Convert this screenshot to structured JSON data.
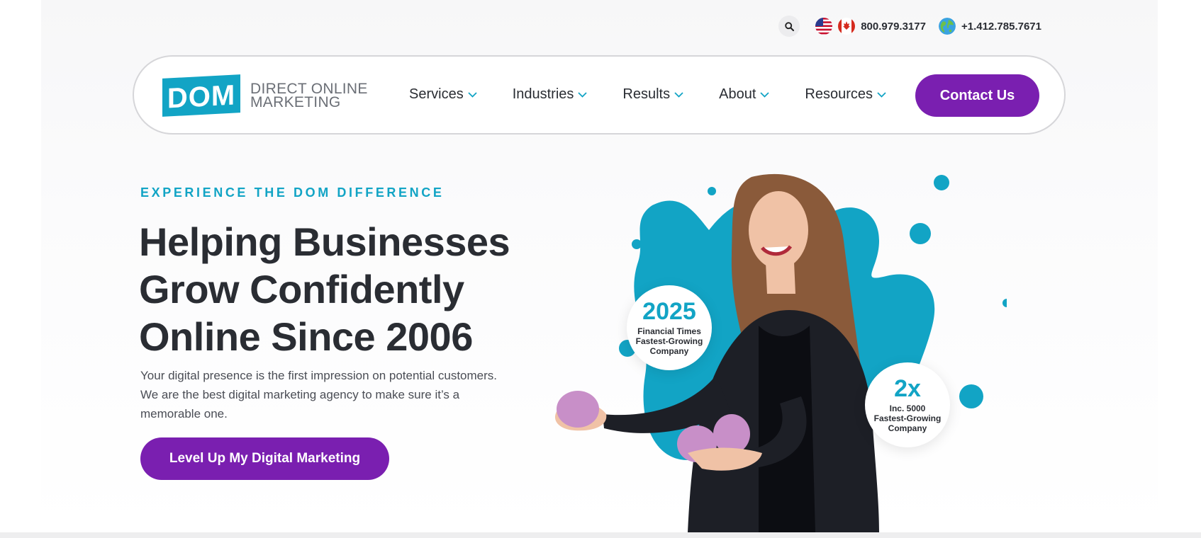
{
  "utility": {
    "phone_us_ca": "800.979.3177",
    "phone_intl": "+1.412.785.7671"
  },
  "logo": {
    "mark": "DOM",
    "line1": "DIRECT ONLINE",
    "line2": "MARKETING"
  },
  "nav": {
    "items": [
      {
        "label": "Services"
      },
      {
        "label": "Industries"
      },
      {
        "label": "Results"
      },
      {
        "label": "About"
      },
      {
        "label": "Resources"
      }
    ],
    "contact_label": "Contact Us"
  },
  "hero": {
    "eyebrow": "EXPERIENCE THE DOM DIFFERENCE",
    "headline_line1": "Helping Businesses",
    "headline_line2": "Grow Confidently",
    "headline_line3": "Online Since 2006",
    "subtext": "Your digital presence is the first impression on potential customers. We are the best digital marketing agency to make sure it’s a memorable one.",
    "cta_label": "Level Up My Digital Marketing"
  },
  "badges": {
    "ft": {
      "big": "2025",
      "line1": "Financial Times",
      "line2": "Fastest-Growing",
      "line3": "Company"
    },
    "inc": {
      "big": "2x",
      "line1": "Inc. 5000",
      "line2": "Fastest-Growing",
      "line3": "Company"
    }
  },
  "colors": {
    "accent_teal": "#12a4c5",
    "accent_purple": "#7a1fb0",
    "text_dark": "#2a2d33"
  },
  "icons": [
    "search-icon",
    "us-flag-icon",
    "canada-flag-icon",
    "globe-icon",
    "chevron-down-icon"
  ]
}
